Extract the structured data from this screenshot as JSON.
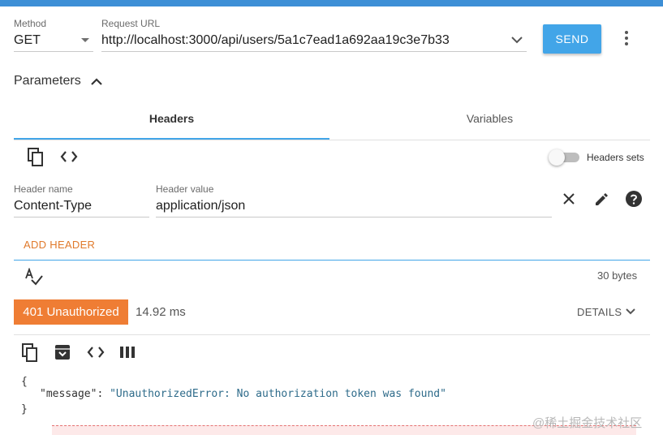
{
  "request": {
    "method_label": "Method",
    "method_value": "GET",
    "url_label": "Request URL",
    "url_value": "http://localhost:3000/api/users/5a1c7ead1a692aa19c3e7b33",
    "send_label": "SEND"
  },
  "parameters": {
    "title": "Parameters",
    "tabs": [
      {
        "label": "Headers",
        "active": true
      },
      {
        "label": "Variables",
        "active": false
      }
    ],
    "headers_sets_label": "Headers sets",
    "headers_sets_enabled": false,
    "header_row": {
      "name_label": "Header name",
      "name_value": "Content-Type",
      "value_label": "Header value",
      "value_value": "application/json"
    },
    "add_header_label": "ADD HEADER",
    "size_label": "30 bytes"
  },
  "response": {
    "status_label": "401 Unauthorized",
    "timing": "14.92 ms",
    "details_label": "DETAILS",
    "body_lines": {
      "open": "{",
      "key": "\"message\"",
      "sep": ": ",
      "value": "\"UnauthorizedError: No authorization token was found\"",
      "close": "}"
    }
  },
  "watermark": "@稀土掘金技术社区",
  "colors": {
    "accent": "#42a5e8",
    "status_error": "#ef7d34",
    "add_header": "#e07a2c",
    "topbar": "#3d8fd6"
  },
  "icons": {
    "toolbar": [
      "copy-icon",
      "code-icon"
    ],
    "row_actions": [
      "close-icon",
      "edit-icon",
      "help-icon"
    ],
    "response_toolbar": [
      "copy-icon",
      "archive-icon",
      "code-icon",
      "columns-icon"
    ],
    "spellcheck": "spellcheck-icon"
  }
}
